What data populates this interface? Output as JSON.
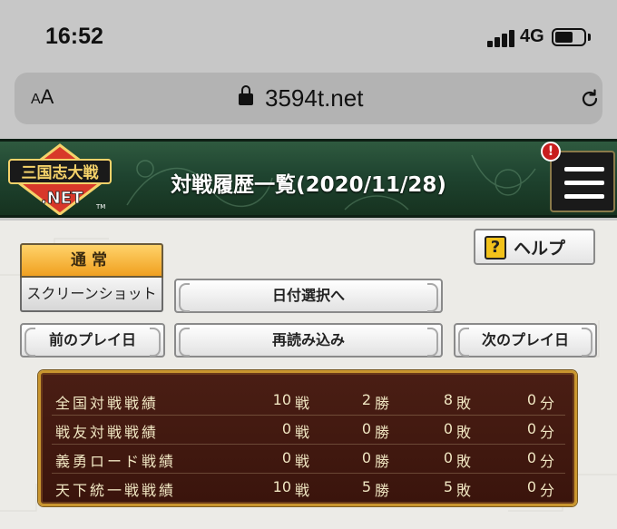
{
  "status_bar": {
    "time": "16:52",
    "network": "4G"
  },
  "browser": {
    "aa_label_small": "A",
    "aa_label_large": "A",
    "url": "3594t.net"
  },
  "header": {
    "title": "対戦履歴一覧(2020/11/28)",
    "alert_badge": "!",
    "logo_alt": "三国志大戦.NET"
  },
  "mode_tabs": {
    "normal": "通常",
    "screenshot": "スクリーンショット"
  },
  "buttons": {
    "help": "ヘルプ",
    "help_icon": "?",
    "date_select": "日付選択へ",
    "prev_day": "前のプレイ日",
    "reload": "再読み込み",
    "next_day": "次のプレイ日"
  },
  "stats": {
    "rows": [
      {
        "label": "全国対戦戦績",
        "battles": "10",
        "wins": "2",
        "losses": "8",
        "draws": "0"
      },
      {
        "label": "戦友対戦戦績",
        "battles": "0",
        "wins": "0",
        "losses": "0",
        "draws": "0"
      },
      {
        "label": "義勇ロード戦績",
        "battles": "0",
        "wins": "0",
        "losses": "0",
        "draws": "0"
      },
      {
        "label": "天下統一戦戦績",
        "battles": "10",
        "wins": "5",
        "losses": "5",
        "draws": "0"
      }
    ],
    "units": {
      "battles": "戦",
      "wins": "勝",
      "losses": "敗",
      "draws": "分"
    }
  },
  "colors": {
    "header_green": "#1f4430",
    "panel_brown": "#3a140c",
    "panel_gold": "#c9962f",
    "tab_orange": "#f0a020"
  },
  "icons": {
    "lock": "lock-icon",
    "reload": "reload-icon",
    "menu": "hamburger-menu-icon",
    "help": "question-mark-icon"
  }
}
